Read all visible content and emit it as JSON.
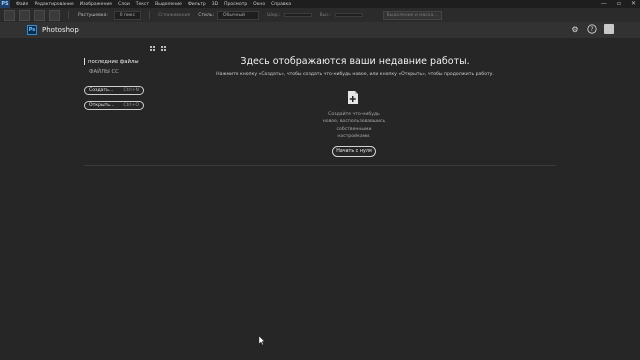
{
  "menubar": {
    "logo": "PS",
    "items": [
      "Файл",
      "Редактирование",
      "Изображение",
      "Слои",
      "Текст",
      "Выделение",
      "Фильтр",
      "3D",
      "Просмотр",
      "Окно",
      "Справка"
    ],
    "window_controls": [
      "—",
      "▫",
      "✕"
    ]
  },
  "options_bar": {
    "feather_label": "Растушевка:",
    "feather_value": "0 пикс",
    "antialias_label": "Сглаживание",
    "style_label": "Стиль:",
    "style_value": "Обычный",
    "width_label": "Шир.:",
    "height_label": "Выс.:",
    "refine_label": "Выделение и маска..."
  },
  "header": {
    "logo": "Ps",
    "app_name": "Photoshop",
    "icons": [
      "gear-icon",
      "help-icon",
      "user-avatar"
    ]
  },
  "sidebar": {
    "active_item": "последние файлы",
    "secondary_item": "ФАЙЛЫ CC",
    "create_button": {
      "label": "Создать...",
      "shortcut": "Ctrl+N"
    },
    "open_button": {
      "label": "Открыть...",
      "shortcut": "Ctrl+O"
    }
  },
  "main": {
    "title": "Здесь отображаются ваши недавние работы.",
    "subtitle": "Нажмите кнопку «Создать», чтобы создать что-нибудь новое, или кнопку «Открыть», чтобы продолжить работу.",
    "desc_line1": "Создайте что-нибудь",
    "desc_line2": "новое, воспользовавшись",
    "desc_line3": "собственными",
    "desc_line4": "настройками.",
    "start_button": "Начать с нуля"
  }
}
